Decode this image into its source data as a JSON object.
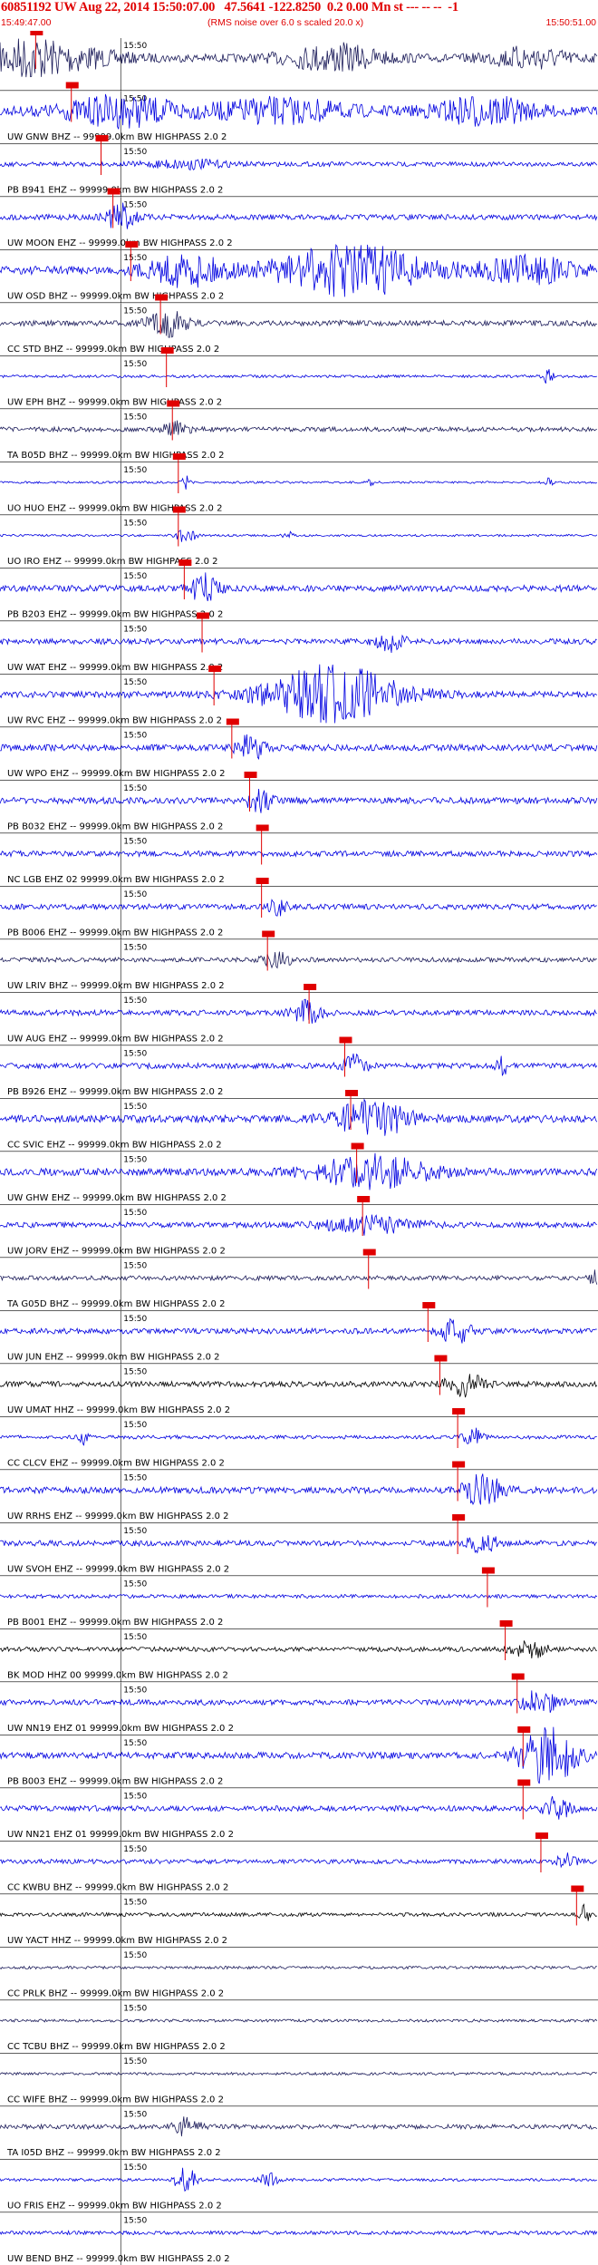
{
  "header": {
    "title": "60851192 UW Aug 22, 2014 15:50:07.00   47.5641 -122.8250  0.2 0.00 Mn st --- -- --  -1",
    "start_time": "15:49:47.00",
    "note": "(RMS noise over 6.0 s scaled 20.0 x)",
    "end_time": "15:50:51.00"
  },
  "chart_data": {
    "type": "seismogram",
    "time_window": [
      "15:49:47.00",
      "15:50:51.00"
    ],
    "tick_label": "15:50",
    "trace_label_suffix": " -- 99999.0km BW  HIGHPASS  2.0  2",
    "colors": {
      "trace": "#0000e0",
      "black_trace": "#000000",
      "dark_trace": "#1c1c5a",
      "pick": "#e00000",
      "text": "#000000"
    },
    "traces": [
      {
        "label": "",
        "color": "dark_trace",
        "amp": 0.45,
        "bursts": [
          [
            2,
            7,
            0.4
          ],
          [
            6,
            12,
            0.5
          ],
          [
            36,
            10,
            0.5
          ],
          [
            57,
            8,
            0.4
          ]
        ],
        "pick": 0.06
      },
      {
        "label": "UW GNW BHZ -- 99999.0km BW  HIGHPASS  2.0  2",
        "color": "trace",
        "amp": 0.5,
        "bursts": [
          [
            13,
            12,
            0.5
          ],
          [
            30,
            14,
            0.4
          ],
          [
            52,
            10,
            0.5
          ]
        ],
        "pick": 0.12
      },
      {
        "label": "PB B941 EHZ -- 99999.0km BW  HIGHPASS  2.0  2",
        "color": "trace",
        "amp": 0.25,
        "bursts": [
          [
            20,
            8,
            0.3
          ]
        ],
        "pick": 0.17
      },
      {
        "label": "UW MOON EHZ -- 99999.0km BW  HIGHPASS  2.0  2",
        "color": "trace",
        "amp": 0.3,
        "bursts": [
          [
            13,
            3,
            0.9
          ]
        ],
        "pick": 0.19
      },
      {
        "label": "UW OSD BHZ -- 99999.0km BW  HIGHPASS  2.0  2",
        "color": "trace",
        "amp": 0.45,
        "bursts": [
          [
            20,
            8,
            0.6
          ],
          [
            38,
            16,
            1.0
          ],
          [
            57,
            10,
            0.5
          ]
        ],
        "pick": 0.22
      },
      {
        "label": "CC STD BHZ -- 99999.0km BW  HIGHPASS  2.0  2",
        "color": "dark_trace",
        "amp": 0.3,
        "bursts": [
          [
            18,
            4,
            0.8
          ]
        ],
        "pick": 0.27
      },
      {
        "label": "UW EPH BHZ -- 99999.0km BW  HIGHPASS  2.0  2",
        "color": "trace",
        "amp": 0.15,
        "bursts": [
          [
            59,
            1,
            1.0
          ]
        ],
        "pick": 0.28
      },
      {
        "label": "TA B05D BHZ -- 99999.0km BW  HIGHPASS  2.0  2",
        "color": "dark_trace",
        "amp": 0.25,
        "bursts": [
          [
            19,
            3,
            0.5
          ]
        ],
        "pick": 0.29
      },
      {
        "label": "UO HUO EHZ -- 99999.0km BW  HIGHPASS  2.0  2",
        "color": "trace",
        "amp": 0.12,
        "bursts": [
          [
            20,
            1,
            1.0
          ],
          [
            40,
            1,
            0.6
          ],
          [
            59,
            1,
            0.6
          ]
        ],
        "pick": 0.3
      },
      {
        "label": "UO IRO EHZ -- 99999.0km BW  HIGHPASS  2.0  2",
        "color": "trace",
        "amp": 0.12,
        "bursts": [
          [
            20,
            2,
            1.3
          ],
          [
            31,
            1,
            0.6
          ]
        ],
        "pick": 0.3
      },
      {
        "label": "PB B203 EHZ -- 99999.0km BW  HIGHPASS  2.0  2",
        "color": "trace",
        "amp": 0.35,
        "bursts": [
          [
            22,
            3,
            0.7
          ]
        ],
        "pick": 0.31
      },
      {
        "label": "UW WAT EHZ -- 99999.0km BW  HIGHPASS  2.0  2",
        "color": "trace",
        "amp": 0.3,
        "bursts": [
          [
            42,
            3,
            0.6
          ]
        ],
        "pick": 0.34
      },
      {
        "label": "UW RVC EHZ -- 99999.0km BW  HIGHPASS  2.0  2",
        "color": "trace",
        "amp": 0.35,
        "bursts": [
          [
            36,
            14,
            1.5
          ]
        ],
        "pick": 0.36
      },
      {
        "label": "UW WPO EHZ -- 99999.0km BW  HIGHPASS  2.0  2",
        "color": "trace",
        "amp": 0.35,
        "bursts": [
          [
            27,
            3,
            0.6
          ]
        ],
        "pick": 0.39
      },
      {
        "label": "PB B032 EHZ -- 99999.0km BW  HIGHPASS  2.0  2",
        "color": "trace",
        "amp": 0.35,
        "bursts": [
          [
            28,
            3,
            0.5
          ]
        ],
        "pick": 0.42
      },
      {
        "label": "NC LGB EHZ 02 99999.0km BW  HIGHPASS  2.0  2",
        "color": "trace",
        "amp": 0.3,
        "bursts": [],
        "pick": 0.44
      },
      {
        "label": "PB B006 EHZ -- 99999.0km BW  HIGHPASS  2.0  2",
        "color": "trace",
        "amp": 0.3,
        "bursts": [
          [
            30,
            2,
            0.5
          ]
        ],
        "pick": 0.44
      },
      {
        "label": "UW LRIV BHZ -- 99999.0km BW  HIGHPASS  2.0  2",
        "color": "dark_trace",
        "amp": 0.25,
        "bursts": [
          [
            30,
            3,
            0.6
          ]
        ],
        "pick": 0.45
      },
      {
        "label": "UW AUG EHZ -- 99999.0km BW  HIGHPASS  2.0  2",
        "color": "trace",
        "amp": 0.3,
        "bursts": [
          [
            33,
            3,
            0.7
          ]
        ],
        "pick": 0.52
      },
      {
        "label": "PB B926 EHZ -- 99999.0km BW  HIGHPASS  2.0  2",
        "color": "trace",
        "amp": 0.3,
        "bursts": [
          [
            38,
            3,
            0.6
          ],
          [
            54,
            1,
            1.2
          ]
        ],
        "pick": 0.58
      },
      {
        "label": "CC SVIC EHZ -- 99999.0km BW  HIGHPASS  2.0  2",
        "color": "trace",
        "amp": 0.4,
        "bursts": [
          [
            40,
            8,
            0.8
          ]
        ],
        "pick": 0.59
      },
      {
        "label": "UW GHW EHZ -- 99999.0km BW  HIGHPASS  2.0  2",
        "color": "trace",
        "amp": 0.4,
        "bursts": [
          [
            40,
            12,
            0.7
          ]
        ],
        "pick": 0.6
      },
      {
        "label": "UW JORV EHZ -- 99999.0km BW  HIGHPASS  2.0  2",
        "color": "trace",
        "amp": 0.3,
        "bursts": [
          [
            40,
            10,
            0.5
          ]
        ],
        "pick": 0.61
      },
      {
        "label": "TA G05D BHZ -- 99999.0km BW  HIGHPASS  2.0  2",
        "color": "dark_trace",
        "amp": 0.25,
        "bursts": [
          [
            64,
            1,
            0.8
          ]
        ],
        "pick": 0.62
      },
      {
        "label": "UW JUN EHZ -- 99999.0km BW  HIGHPASS  2.0  2",
        "color": "trace",
        "amp": 0.3,
        "bursts": [
          [
            49,
            3,
            0.8
          ]
        ],
        "pick": 0.72
      },
      {
        "label": "UW UMAT HHZ -- 99999.0km BW  HIGHPASS  2.0  2",
        "color": "black_trace",
        "amp": 0.3,
        "bursts": [
          [
            50,
            4,
            0.7
          ]
        ],
        "pick": 0.74
      },
      {
        "label": "CC CLCV EHZ -- 99999.0km BW  HIGHPASS  2.0  2",
        "color": "trace",
        "amp": 0.2,
        "bursts": [
          [
            9,
            1,
            0.6
          ],
          [
            51,
            2,
            0.8
          ]
        ],
        "pick": 0.77
      },
      {
        "label": "UW RRHS EHZ -- 99999.0km BW  HIGHPASS  2.0  2",
        "color": "trace",
        "amp": 0.35,
        "bursts": [
          [
            52,
            4,
            0.8
          ]
        ],
        "pick": 0.77
      },
      {
        "label": "UW SVOH EHZ -- 99999.0km BW  HIGHPASS  2.0  2",
        "color": "trace",
        "amp": 0.3,
        "bursts": [
          [
            52,
            3,
            0.6
          ]
        ],
        "pick": 0.77
      },
      {
        "label": "PB B001 EHZ -- 99999.0km BW  HIGHPASS  2.0  2",
        "color": "trace",
        "amp": 0.2,
        "bursts": [],
        "pick": 0.82
      },
      {
        "label": "BK MOD HHZ 00 99999.0km BW  HIGHPASS  2.0  2",
        "color": "black_trace",
        "amp": 0.25,
        "bursts": [
          [
            57,
            4,
            0.6
          ]
        ],
        "pick": 0.85
      },
      {
        "label": "UW NN19 EHZ 01 99999.0km BW  HIGHPASS  2.0  2",
        "color": "trace",
        "amp": 0.3,
        "bursts": [
          [
            58,
            4,
            0.7
          ]
        ],
        "pick": 0.87
      },
      {
        "label": "PB B003 EHZ -- 99999.0km BW  HIGHPASS  2.0  2",
        "color": "trace",
        "amp": 0.35,
        "bursts": [
          [
            59,
            6,
            1.5
          ]
        ],
        "pick": 0.88
      },
      {
        "label": "UW NN21 EHZ 01 99999.0km BW  HIGHPASS  2.0  2",
        "color": "trace",
        "amp": 0.3,
        "bursts": [
          [
            60,
            3,
            0.7
          ]
        ],
        "pick": 0.88
      },
      {
        "label": "CC KWBU BHZ -- 99999.0km BW  HIGHPASS  2.0  2",
        "color": "trace",
        "amp": 0.25,
        "bursts": [
          [
            61,
            2,
            0.5
          ]
        ],
        "pick": 0.91
      },
      {
        "label": "UW YACT HHZ -- 99999.0km BW  HIGHPASS  2.0  2",
        "color": "black_trace",
        "amp": 0.2,
        "bursts": [
          [
            63,
            1,
            1.0
          ]
        ],
        "pick": 0.97
      },
      {
        "label": "CC PRLK BHZ -- 99999.0km BW  HIGHPASS  2.0  2",
        "color": "dark_trace",
        "amp": 0.15,
        "bursts": [],
        "pick": null
      },
      {
        "label": "CC TCBU BHZ -- 99999.0km BW  HIGHPASS  2.0  2",
        "color": "dark_trace",
        "amp": 0.15,
        "bursts": [],
        "pick": null
      },
      {
        "label": "CC WIFE BHZ -- 99999.0km BW  HIGHPASS  2.0  2",
        "color": "dark_trace",
        "amp": 0.15,
        "bursts": [],
        "pick": null
      },
      {
        "label": "TA I05D BHZ -- 99999.0km BW  HIGHPASS  2.0  2",
        "color": "dark_trace",
        "amp": 0.25,
        "bursts": [
          [
            20,
            3,
            0.6
          ]
        ],
        "pick": null
      },
      {
        "label": "UO FRIS EHZ -- 99999.0km BW  HIGHPASS  2.0  2",
        "color": "trace",
        "amp": 0.15,
        "bursts": [
          [
            20,
            2,
            2.2
          ],
          [
            29,
            2,
            0.8
          ]
        ],
        "pick": null
      },
      {
        "label": "UW BEND BHZ -- 99999.0km BW  HIGHPASS  2.0  2",
        "color": "trace",
        "amp": 0.2,
        "bursts": [],
        "pick": null
      }
    ]
  }
}
